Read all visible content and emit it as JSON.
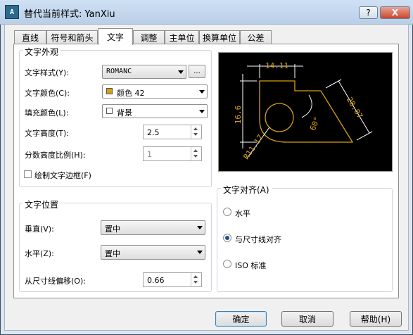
{
  "window": {
    "title": "替代当前样式: YanXiu",
    "help_glyph": "?",
    "close_glyph": "X",
    "app_icon": "cad-app-icon"
  },
  "tabs": [
    {
      "label": "直线"
    },
    {
      "label": "符号和箭头"
    },
    {
      "label": "文字"
    },
    {
      "label": "调整"
    },
    {
      "label": "主单位"
    },
    {
      "label": "换算单位"
    },
    {
      "label": "公差"
    }
  ],
  "text_appearance": {
    "group_label": "文字外观",
    "style_label": "文字样式(Y):",
    "style_value": "ROMANC",
    "style_browse": "...",
    "color_label": "文字颜色(C):",
    "color_value": "颜色 42",
    "color_swatch": "#d8a010",
    "fill_label": "填充颜色(L):",
    "fill_value": "背景",
    "height_label": "文字高度(T):",
    "height_value": "2.5",
    "fraction_label": "分数高度比例(H):",
    "fraction_value": "1",
    "frame_label": "绘制文字边框(F)",
    "frame_checked": false
  },
  "text_placement": {
    "group_label": "文字位置",
    "vertical_label": "垂直(V):",
    "vertical_value": "置中",
    "horizontal_label": "水平(Z):",
    "horizontal_value": "置中",
    "offset_label": "从尺寸线偏移(O):",
    "offset_value": "0.66"
  },
  "text_alignment": {
    "group_label": "文字对齐(A)",
    "options": [
      {
        "label": "水平",
        "selected": false
      },
      {
        "label": "与尺寸线对齐",
        "selected": true
      },
      {
        "label": "ISO 标准",
        "selected": false
      }
    ]
  },
  "preview": {
    "dim_top": "14.11",
    "dim_left": "16.6",
    "dim_right": "28.07",
    "dim_angle": "60°",
    "dim_radius": "R11.17",
    "line_color": "#d8a010",
    "dim_color": "#ffffff"
  },
  "buttons": {
    "ok": "确定",
    "cancel": "取消",
    "help": "帮助(H)"
  }
}
